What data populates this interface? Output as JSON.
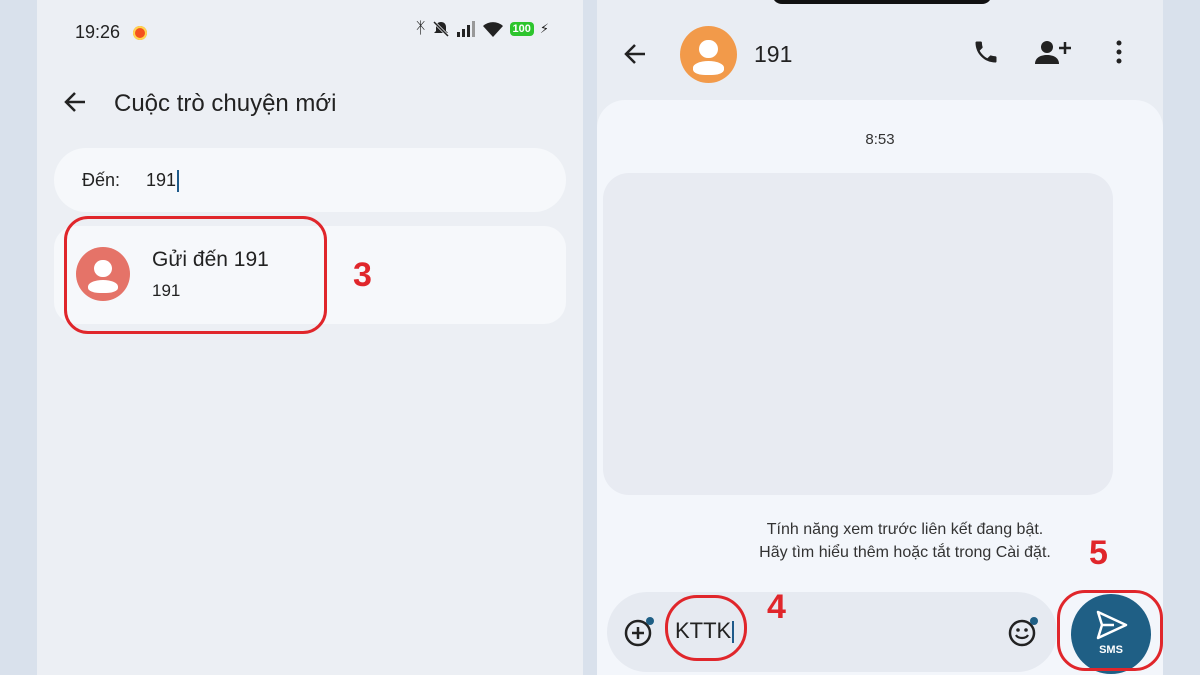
{
  "left": {
    "status": {
      "time": "19:26",
      "battery": "100"
    },
    "title": "Cuộc trò chuyện mới",
    "to": {
      "label": "Đến:",
      "value": "191"
    },
    "suggestion": {
      "name": "Gửi đến 191",
      "number": "191"
    },
    "step": "3"
  },
  "right": {
    "contact": "191",
    "timestamp": "8:53",
    "note": [
      "Tính năng xem trước liên kết đang bật.",
      "Hãy tìm hiểu thêm hoặc tắt trong Cài đặt."
    ],
    "message": "KTTK",
    "send_label": "SMS",
    "step_message": "4",
    "step_send": "5"
  },
  "colors": {
    "highlight": "#e0262b",
    "send": "#1f5f85",
    "avatar_left": "#e57368",
    "avatar_right": "#f29a4a",
    "battery": "#2dc52d"
  }
}
